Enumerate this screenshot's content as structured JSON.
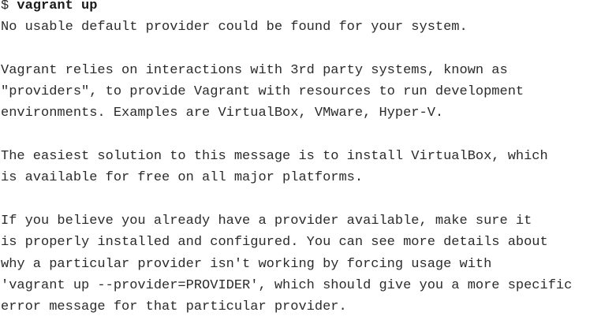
{
  "terminal": {
    "prompt": "$ ",
    "command": "vagrant up",
    "output": [
      "No usable default provider could be found for your system.",
      "",
      "Vagrant relies on interactions with 3rd party systems, known as",
      "\"providers\", to provide Vagrant with resources to run development",
      "environments. Examples are VirtualBox, VMware, Hyper-V.",
      "",
      "The easiest solution to this message is to install VirtualBox, which",
      "is available for free on all major platforms.",
      "",
      "If you believe you already have a provider available, make sure it",
      "is properly installed and configured. You can see more details about",
      "why a particular provider isn't working by forcing usage with",
      "'vagrant up --provider=PROVIDER', which should give you a more specific",
      "error message for that particular provider."
    ]
  }
}
